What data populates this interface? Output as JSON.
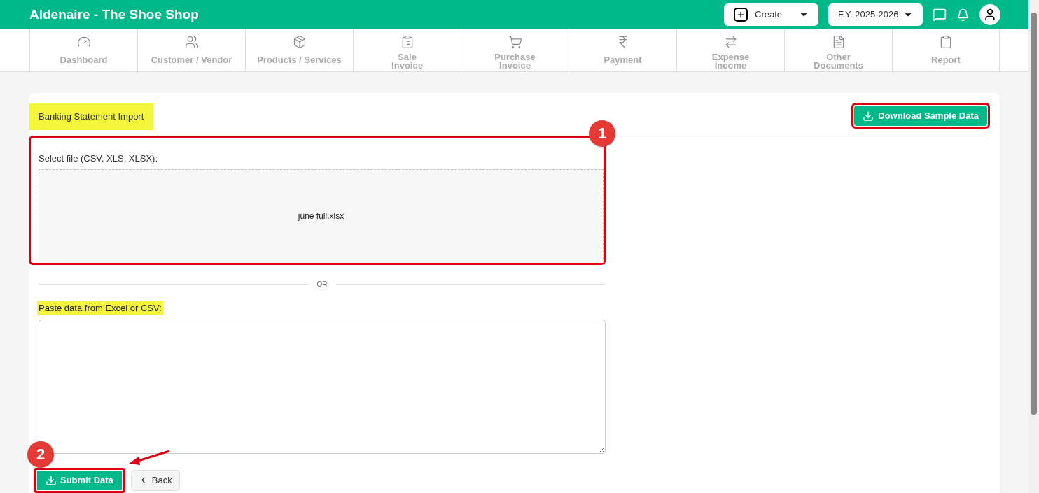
{
  "header": {
    "title": "Aldenaire - The Shoe Shop",
    "create": "Create",
    "fiscal_year": "F.Y. 2025-2026"
  },
  "nav": [
    {
      "kind": "gauge",
      "lines": [
        "Dashboard"
      ]
    },
    {
      "kind": "users",
      "lines": [
        "Customer / Vendor"
      ]
    },
    {
      "kind": "box",
      "lines": [
        "Products / Services"
      ]
    },
    {
      "kind": "invoice",
      "lines": [
        "Sale",
        "Invoice"
      ]
    },
    {
      "kind": "cart",
      "lines": [
        "Purchase",
        "Invoice"
      ]
    },
    {
      "kind": "rupee",
      "lines": [
        "Payment"
      ]
    },
    {
      "kind": "expense",
      "lines": [
        "Expense",
        "Income"
      ]
    },
    {
      "kind": "doc",
      "lines": [
        "Other",
        "Documents"
      ]
    },
    {
      "kind": "report",
      "lines": [
        "Report"
      ]
    }
  ],
  "page": {
    "title": "Banking Statement Import",
    "download": "Download Sample Data",
    "file_label": "Select file (CSV, XLS, XLSX):",
    "file_name": "june full.xlsx",
    "divider": "OR",
    "paste_label": "Paste data from Excel or CSV:",
    "submit": "Submit Data",
    "back": "Back"
  },
  "annotations": [
    "1",
    "2"
  ]
}
